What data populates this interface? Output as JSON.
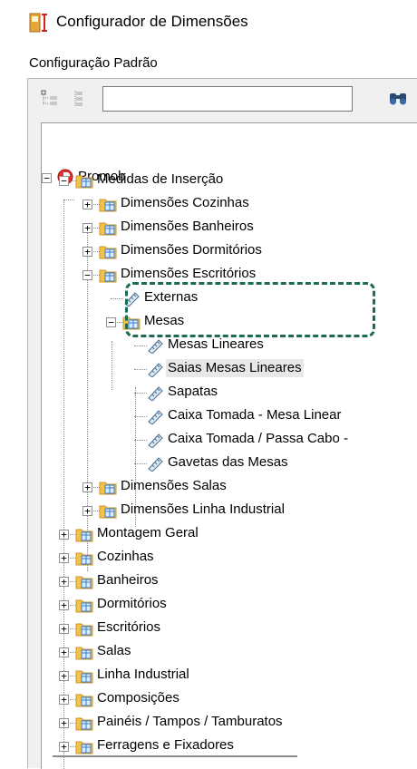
{
  "window": {
    "title": "Configurador de Dimensões"
  },
  "section": {
    "label": "Configuração Padrão"
  },
  "toolbar": {
    "search_value": ""
  },
  "colors": {
    "highlight": "#1a6b55",
    "folder": "#f4c24a",
    "root": "#e03030"
  },
  "tree": {
    "root": "Promob",
    "medidas": "Medidas de Inserção",
    "cozinhas_dim": "Dimensões Cozinhas",
    "banheiros_dim": "Dimensões Banheiros",
    "dormitorios_dim": "Dimensões Dormitórios",
    "escritorios_dim": "Dimensões Escritórios",
    "externas": "Externas",
    "mesas": "Mesas",
    "mesas_lineares": "Mesas Lineares",
    "saias": "Saias Mesas Lineares",
    "sapatas": "Sapatas",
    "caixa1": "Caixa Tomada - Mesa Linear",
    "caixa2": "Caixa Tomada / Passa Cabo -",
    "gavetas": "Gavetas das Mesas",
    "salas_dim": "Dimensões Salas",
    "linha_dim": "Dimensões Linha Industrial",
    "montagem": "Montagem Geral",
    "cozinhas": "Cozinhas",
    "banheiros": "Banheiros",
    "dormitorios": "Dormitórios",
    "escritorios": "Escritórios",
    "salas": "Salas",
    "linha": "Linha Industrial",
    "composicoes": "Composições",
    "paineis": "Painéis / Tampos / Tamburatos",
    "ferragens": "Ferragens e Fixadores"
  }
}
